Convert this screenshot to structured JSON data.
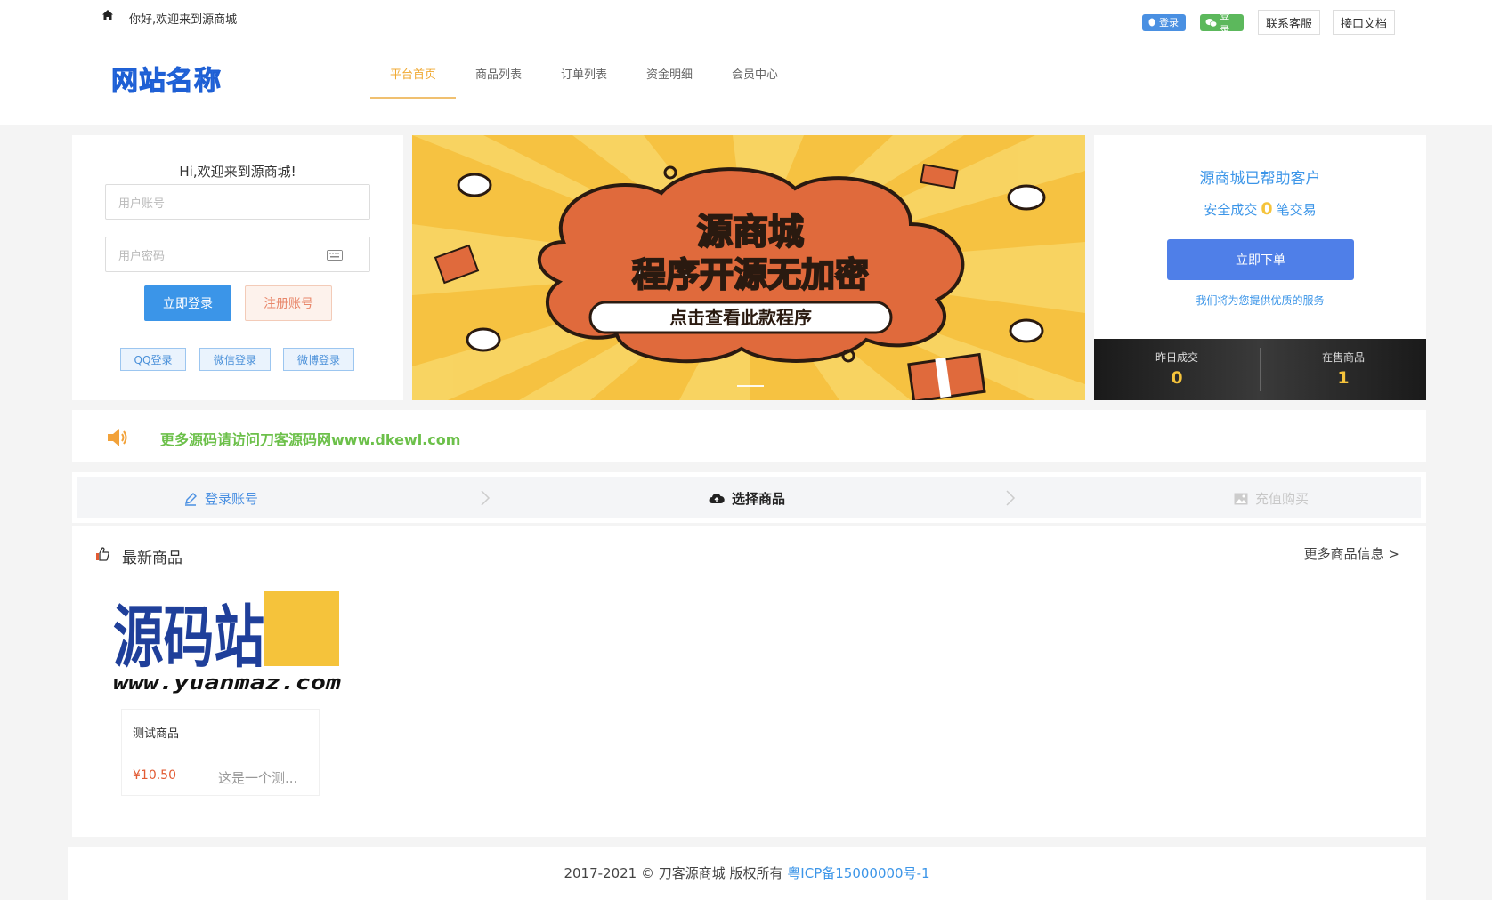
{
  "header": {
    "welcome": "你好,欢迎来到源商城",
    "qq_login": "登录",
    "wx_login": "登录",
    "contact": "联系客服",
    "api_doc": "接口文档",
    "logo": "网站名称",
    "nav": [
      {
        "label": "平台首页",
        "active": true
      },
      {
        "label": "商品列表",
        "active": false
      },
      {
        "label": "订单列表",
        "active": false
      },
      {
        "label": "资金明细",
        "active": false
      },
      {
        "label": "会员中心",
        "active": false
      }
    ]
  },
  "login": {
    "title": "Hi,欢迎来到源商城!",
    "user_placeholder": "用户账号",
    "pass_placeholder": "用户密码",
    "login_btn": "立即登录",
    "register_btn": "注册账号",
    "qq": "QQ登录",
    "wechat": "微信登录",
    "weibo": "微博登录"
  },
  "banner": {
    "title": "源商城",
    "subtitle": "程序开源无加密",
    "cta": "点击查看此款程序"
  },
  "stats": {
    "title": "源商城已帮助客户",
    "line_prefix": "安全成交",
    "line_num": "0",
    "line_suffix": "笔交易",
    "order_btn": "立即下单",
    "note": "我们将为您提供优质的服务",
    "yesterday_label": "昨日成交",
    "yesterday_value": "0",
    "onsale_label": "在售商品",
    "onsale_value": "1"
  },
  "notice": {
    "text": "更多源码请访问刀客源码网www.dkewl.com"
  },
  "steps": [
    {
      "label": "登录账号",
      "icon": "pencil-icon"
    },
    {
      "label": "选择商品",
      "icon": "cloud-upload-icon"
    },
    {
      "label": "充值购买",
      "icon": "image-icon"
    }
  ],
  "products": {
    "heading": "最新商品",
    "more": "更多商品信息 >",
    "image_text": "源码站",
    "image_url_text": "www.yuanmaz.com",
    "items": [
      {
        "name": "测试商品",
        "price": "¥10.50",
        "desc": "这是一个测..."
      }
    ]
  },
  "footer": {
    "copyright": "2017-2021 © 刀客源商城 版权所有 ",
    "icp": "粤ICP备15000000号-1"
  },
  "colors": {
    "accent": "#3b95e8",
    "nav_active": "#f0a830",
    "notice_green": "#6cc04a",
    "price_red": "#e25b33",
    "banner_bg": "#f6c241"
  }
}
